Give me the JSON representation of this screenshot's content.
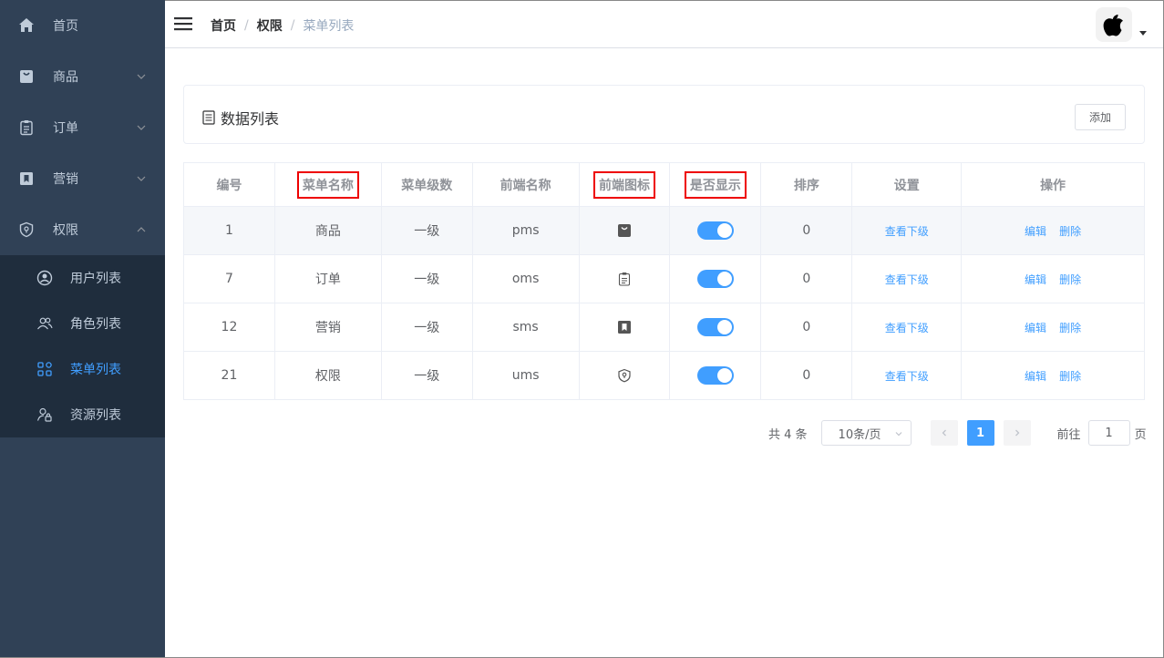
{
  "sidebar": {
    "items": [
      {
        "label": "首页",
        "icon": "home-icon"
      },
      {
        "label": "商品",
        "icon": "shopping-bag-icon"
      },
      {
        "label": "订单",
        "icon": "clipboard-icon"
      },
      {
        "label": "营销",
        "icon": "bookmark-icon"
      },
      {
        "label": "权限",
        "icon": "shield-icon"
      }
    ],
    "submenu": [
      {
        "label": "用户列表",
        "icon": "user-circle-icon"
      },
      {
        "label": "角色列表",
        "icon": "users-icon"
      },
      {
        "label": "菜单列表",
        "icon": "grid-icon",
        "active": true
      },
      {
        "label": "资源列表",
        "icon": "user-lock-icon"
      }
    ]
  },
  "header": {
    "breadcrumb": [
      "首页",
      "权限",
      "菜单列表"
    ],
    "avatar_icon": "apple-icon"
  },
  "card": {
    "title": "数据列表",
    "add_button": "添加"
  },
  "table": {
    "columns": [
      "编号",
      "菜单名称",
      "菜单级数",
      "前端名称",
      "前端图标",
      "是否显示",
      "排序",
      "设置",
      "操作"
    ],
    "rows": [
      {
        "id": "1",
        "name": "商品",
        "level": "一级",
        "front_name": "pms",
        "icon": "shopping-bag-icon",
        "show": true,
        "sort": "0",
        "settings": "查看下级",
        "edit": "编辑",
        "delete": "删除"
      },
      {
        "id": "7",
        "name": "订单",
        "level": "一级",
        "front_name": "oms",
        "icon": "clipboard-icon",
        "show": true,
        "sort": "0",
        "settings": "查看下级",
        "edit": "编辑",
        "delete": "删除"
      },
      {
        "id": "12",
        "name": "营销",
        "level": "一级",
        "front_name": "sms",
        "icon": "bookmark-icon",
        "show": true,
        "sort": "0",
        "settings": "查看下级",
        "edit": "编辑",
        "delete": "删除"
      },
      {
        "id": "21",
        "name": "权限",
        "level": "一级",
        "front_name": "ums",
        "icon": "shield-icon",
        "show": true,
        "sort": "0",
        "settings": "查看下级",
        "edit": "编辑",
        "delete": "删除"
      }
    ]
  },
  "pagination": {
    "total": "共 4 条",
    "page_size": "10条/页",
    "current_page": "1",
    "goto_label": "前往",
    "goto_value": "1",
    "page_unit": "页"
  },
  "colors": {
    "sidebar_bg": "#304156",
    "submenu_bg": "#1f2d3d",
    "accent": "#409eff",
    "highlight_border": "#e00000"
  }
}
